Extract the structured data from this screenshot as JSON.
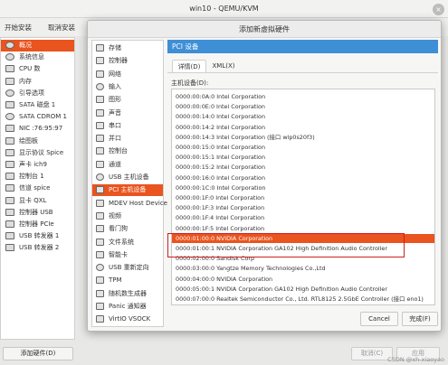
{
  "window": {
    "title": "win10 - QEMU/KVM",
    "close_glyph": "×"
  },
  "toolbar": {
    "begin_install": "开始安装",
    "cancel_install": "取消安装"
  },
  "sidebar": {
    "items": [
      {
        "label": "概况",
        "icon": "info-icon",
        "selected": true
      },
      {
        "label": "系统信息",
        "icon": "info-icon"
      },
      {
        "label": "CPU 数",
        "icon": "cpu-icon"
      },
      {
        "label": "内存",
        "icon": "memory-icon"
      },
      {
        "label": "引导选项",
        "icon": "gear-icon"
      },
      {
        "label": "SATA 磁盘 1",
        "icon": "disk-icon"
      },
      {
        "label": "SATA CDROM 1",
        "icon": "cdrom-icon"
      },
      {
        "label": "NIC :76:95:97",
        "icon": "network-icon"
      },
      {
        "label": "绘图板",
        "icon": "tablet-icon"
      },
      {
        "label": "显示协议 Spice",
        "icon": "display-icon"
      },
      {
        "label": "声卡 ich9",
        "icon": "sound-icon"
      },
      {
        "label": "控制台 1",
        "icon": "console-icon"
      },
      {
        "label": "信道 spice",
        "icon": "channel-icon"
      },
      {
        "label": "显卡 QXL",
        "icon": "video-icon"
      },
      {
        "label": "控制器 USB",
        "icon": "controller-icon"
      },
      {
        "label": "控制器 PCIe",
        "icon": "controller-icon"
      },
      {
        "label": "USB 转发器 1",
        "icon": "usb-icon"
      },
      {
        "label": "USB 转发器 2",
        "icon": "usb-icon"
      }
    ],
    "add_hardware": "添加硬件(D)"
  },
  "background_buttons": {
    "cancel": "取消(C)",
    "apply": "应用"
  },
  "dialog": {
    "title": "添加新虚拟硬件",
    "categories": [
      {
        "label": "存储",
        "icon": "storage-icon"
      },
      {
        "label": "控制器",
        "icon": "controller-icon"
      },
      {
        "label": "网络",
        "icon": "network-icon"
      },
      {
        "label": "输入",
        "icon": "input-icon"
      },
      {
        "label": "图形",
        "icon": "graphics-icon"
      },
      {
        "label": "声音",
        "icon": "sound-icon"
      },
      {
        "label": "串口",
        "icon": "serial-icon"
      },
      {
        "label": "并口",
        "icon": "parallel-icon"
      },
      {
        "label": "控制台",
        "icon": "console-icon"
      },
      {
        "label": "通道",
        "icon": "channel-icon"
      },
      {
        "label": "USB 主机设备",
        "icon": "usb-icon"
      },
      {
        "label": "PCI 主机设备",
        "icon": "pci-icon",
        "selected": true
      },
      {
        "label": "MDEV Host Device",
        "icon": "mdev-icon"
      },
      {
        "label": "视频",
        "icon": "video-icon"
      },
      {
        "label": "看门狗",
        "icon": "watchdog-icon"
      },
      {
        "label": "文件系统",
        "icon": "filesystem-icon"
      },
      {
        "label": "智能卡",
        "icon": "smartcard-icon"
      },
      {
        "label": "USB 重新定向",
        "icon": "usb-icon"
      },
      {
        "label": "TPM",
        "icon": "tpm-icon"
      },
      {
        "label": "随机数生成器",
        "icon": "rng-icon"
      },
      {
        "label": "Panic 通知器",
        "icon": "panic-icon"
      },
      {
        "label": "VirtIO VSOCK",
        "icon": "vsock-icon"
      }
    ],
    "section_header": "PCI 设备",
    "tabs": {
      "details": "详情(D)",
      "xml": "XML(X)"
    },
    "host_device_label": "主机设备(D):",
    "devices": [
      "0000:00:0A:0 Intel Corporation",
      "0000:00:0E:0 Intel Corporation",
      "0000:00:14:0 Intel Corporation",
      "0000:00:14:2 Intel Corporation",
      "0000:00:14:3 Intel Corporation (接口 wlp0s20f3)",
      "0000:00:15:0 Intel Corporation",
      "0000:00:15:1 Intel Corporation",
      "0000:00:15:2 Intel Corporation",
      "0000:00:16:0 Intel Corporation",
      "0000:00:1C:0 Intel Corporation",
      "0000:00:1F:0 Intel Corporation",
      "0000:00:1F:3 Intel Corporation",
      "0000:00:1F:4 Intel Corporation",
      "0000:00:1F:5 Intel Corporation",
      "0000:01:00:0 NVIDIA Corporation",
      "0000:01:00:1 NVIDIA Corporation GA102 High Definition Audio Controller",
      "0000:02:00:0 Sandisk Corp",
      "0000:03:00:0 Yangtze Memory Technologies Co.,Ltd",
      "0000:04:00:0 NVIDIA Corporation",
      "0000:05:00:1 NVIDIA Corporation GA102 High Definition Audio Controller",
      "0000:07:00:0 Realtek Semiconductor Co., Ltd. RTL8125 2.5GbE Controller (接口 eno1)"
    ],
    "selected_device_index": 14,
    "cancel": "Cancel",
    "finish": "完成(F)"
  },
  "watermark": "CSDN @xh-xiaoyao",
  "colors": {
    "accent": "#e9541f",
    "header_blue": "#3f8fd6",
    "highlight_box": "#d21f1f"
  }
}
